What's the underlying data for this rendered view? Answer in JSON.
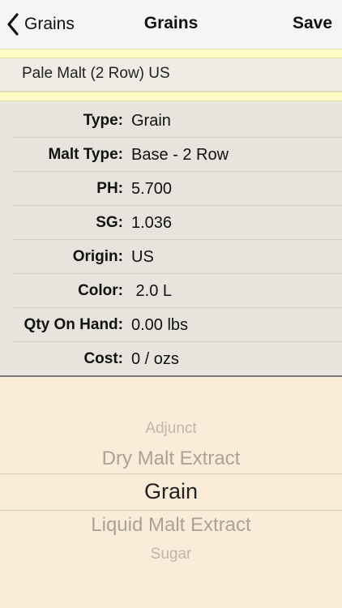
{
  "nav": {
    "back_label": "Grains",
    "title": "Grains",
    "save_label": "Save"
  },
  "ingredient": {
    "name": "Pale Malt (2 Row) US"
  },
  "fields": [
    {
      "label": "Type:",
      "value": "Grain"
    },
    {
      "label": "Malt Type:",
      "value": "Base - 2 Row"
    },
    {
      "label": "PH:",
      "value": "5.700"
    },
    {
      "label": "SG:",
      "value": "1.036"
    },
    {
      "label": "Origin:",
      "value": "US"
    },
    {
      "label": "Color:",
      "value": " 2.0 L"
    },
    {
      "label": "Qty On Hand:",
      "value": "0.00 lbs"
    },
    {
      "label": "Cost:",
      "value": "0 / ozs"
    }
  ],
  "picker": {
    "options": [
      "Adjunct",
      "Dry Malt Extract",
      "Grain",
      "Liquid Malt Extract",
      "Sugar"
    ],
    "selected": "Grain"
  },
  "colors": {
    "picker_bg": "#fbecda",
    "highlight_band": "#fffbc4"
  }
}
